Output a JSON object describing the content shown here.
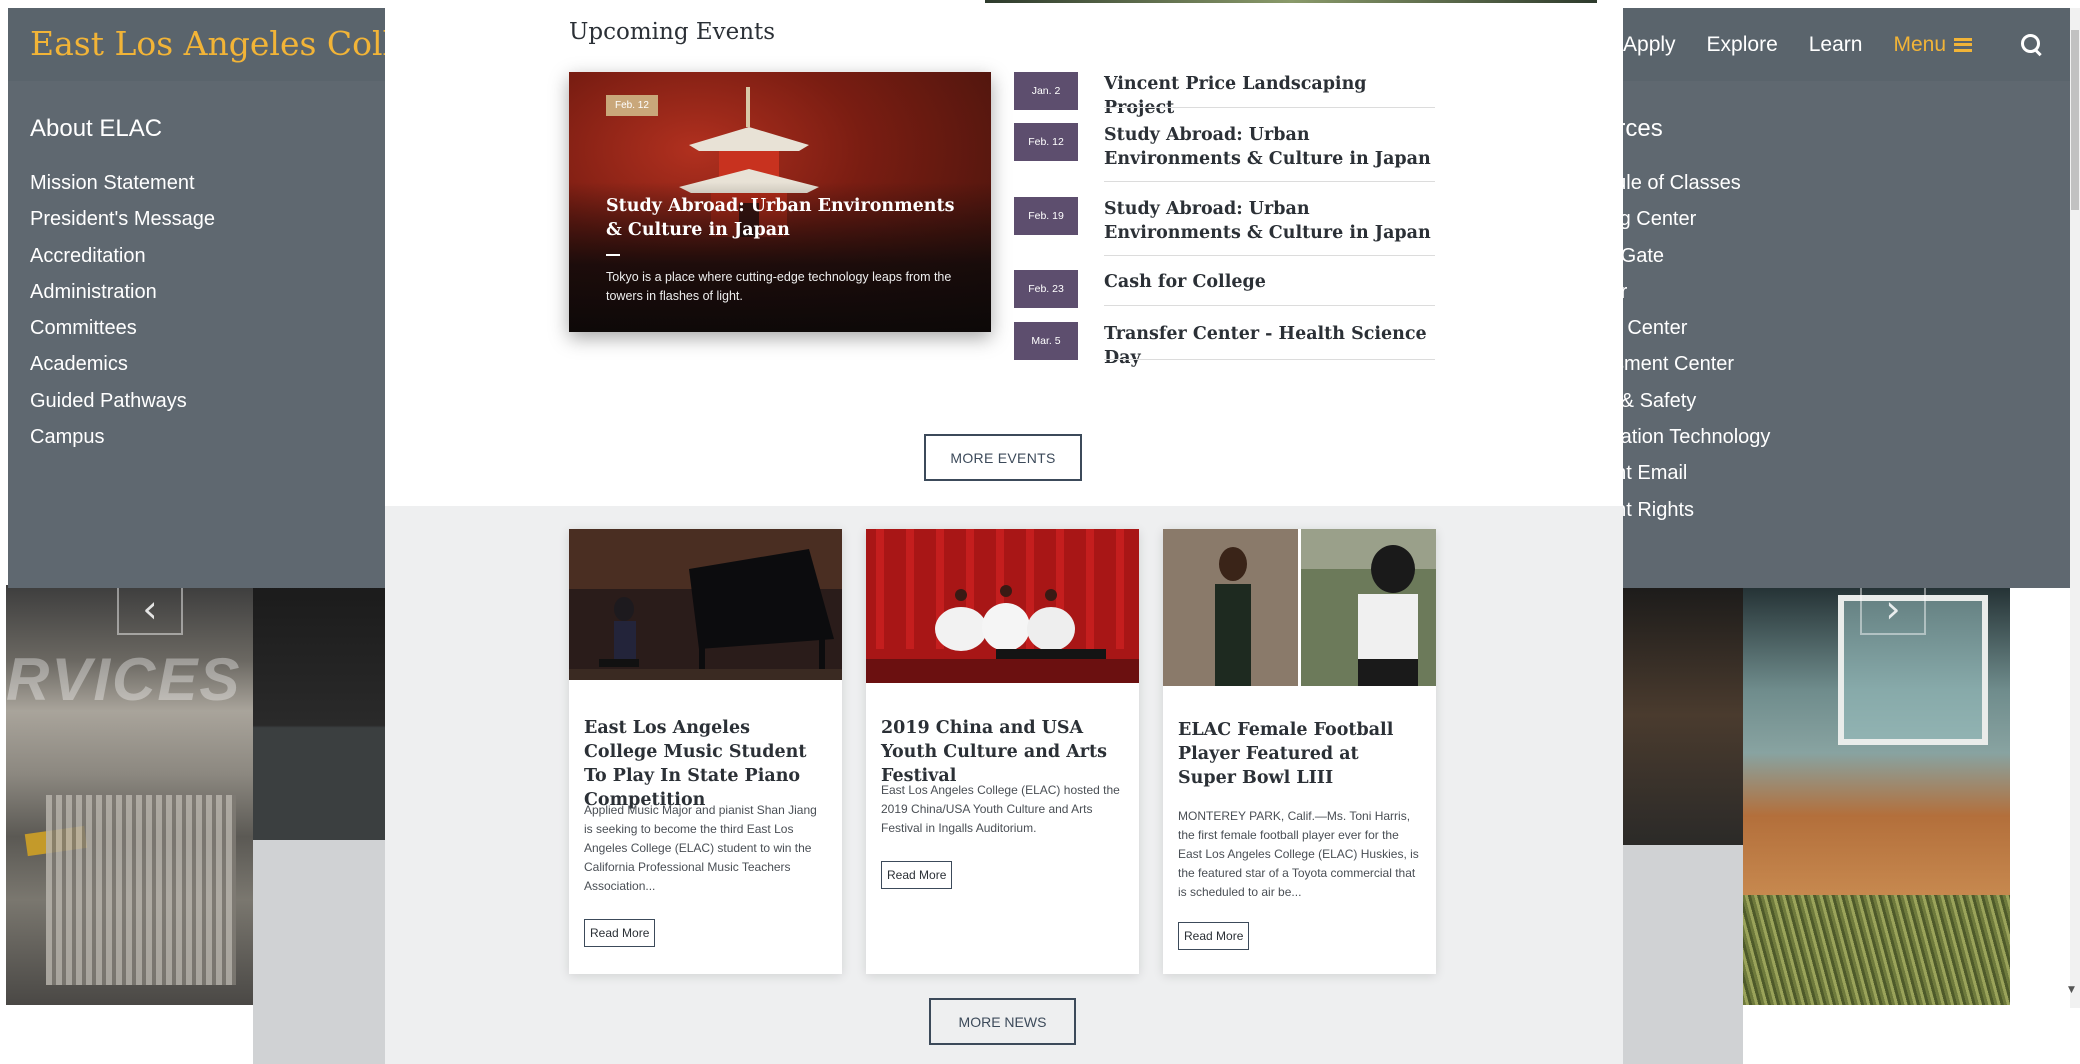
{
  "site": {
    "title": "East Los Angeles Colleg"
  },
  "nav": {
    "items": [
      "Apply",
      "Explore",
      "Learn"
    ],
    "menu_label": "Menu"
  },
  "colors": {
    "accent": "#f2b437",
    "nav_bg": "#5a646c",
    "date_badge": "#5d4e6e"
  },
  "mega_menu": {
    "about": {
      "heading": "About ELAC",
      "links": [
        "Mission Statement",
        "President's Message",
        "Accreditation",
        "Administration",
        "Committees",
        "Academics",
        "Guided Pathways",
        "Campus"
      ]
    },
    "resources": {
      "heading": "urces",
      "links": [
        "dule of Classes",
        "ing Center",
        "n Gate",
        "fer",
        "er Center",
        "ssment Center",
        "h & Safety",
        "mation Technology",
        "ent Email",
        "ent Rights"
      ]
    }
  },
  "background": {
    "sign_text": "RVICES"
  },
  "events": {
    "heading": "Upcoming Events",
    "featured": {
      "date": "Feb. 12",
      "title": "Study Abroad: Urban Environments & Culture in Japan",
      "description": "Tokyo is a place where cutting-edge technology leaps from the towers in flashes of light."
    },
    "list": [
      {
        "date": "Jan. 2",
        "title": "Vincent Price Landscaping Project"
      },
      {
        "date": "Feb. 12",
        "title": "Study Abroad: Urban Environments & Culture in Japan"
      },
      {
        "date": "Feb. 19",
        "title": "Study Abroad: Urban Environments & Culture in Japan"
      },
      {
        "date": "Feb. 23",
        "title": "Cash for College"
      },
      {
        "date": "Mar. 5",
        "title": "Transfer Center - Health Science Day"
      }
    ],
    "more_label": "MORE EVENTS"
  },
  "news": {
    "items": [
      {
        "title": "East Los Angeles College Music Student To Play In State Piano Competition",
        "description": "Applied Music Major and pianist Shan Jiang is seeking to become the third East Los Angeles College (ELAC) student to win the California Professional Music Teachers Association...",
        "read_more": "Read More"
      },
      {
        "title": "2019 China and USA Youth Culture and Arts Festival",
        "description": "East Los Angeles College (ELAC) hosted the 2019 China/USA Youth Culture and Arts Festival in Ingalls Auditorium.",
        "read_more": "Read More"
      },
      {
        "title": "ELAC Female Football Player Featured at Super Bowl LIII",
        "description": "MONTEREY PARK, Calif.—Ms. Toni Harris, the first female football player ever for the East Los Angeles College (ELAC) Huskies, is the featured star of a Toyota commercial that is scheduled to air be...",
        "read_more": "Read More"
      }
    ],
    "more_label": "MORE NEWS"
  },
  "icons": {
    "menu": "hamburger-icon",
    "search": "search-icon",
    "prev": "chevron-left-icon",
    "next": "chevron-right-icon"
  }
}
